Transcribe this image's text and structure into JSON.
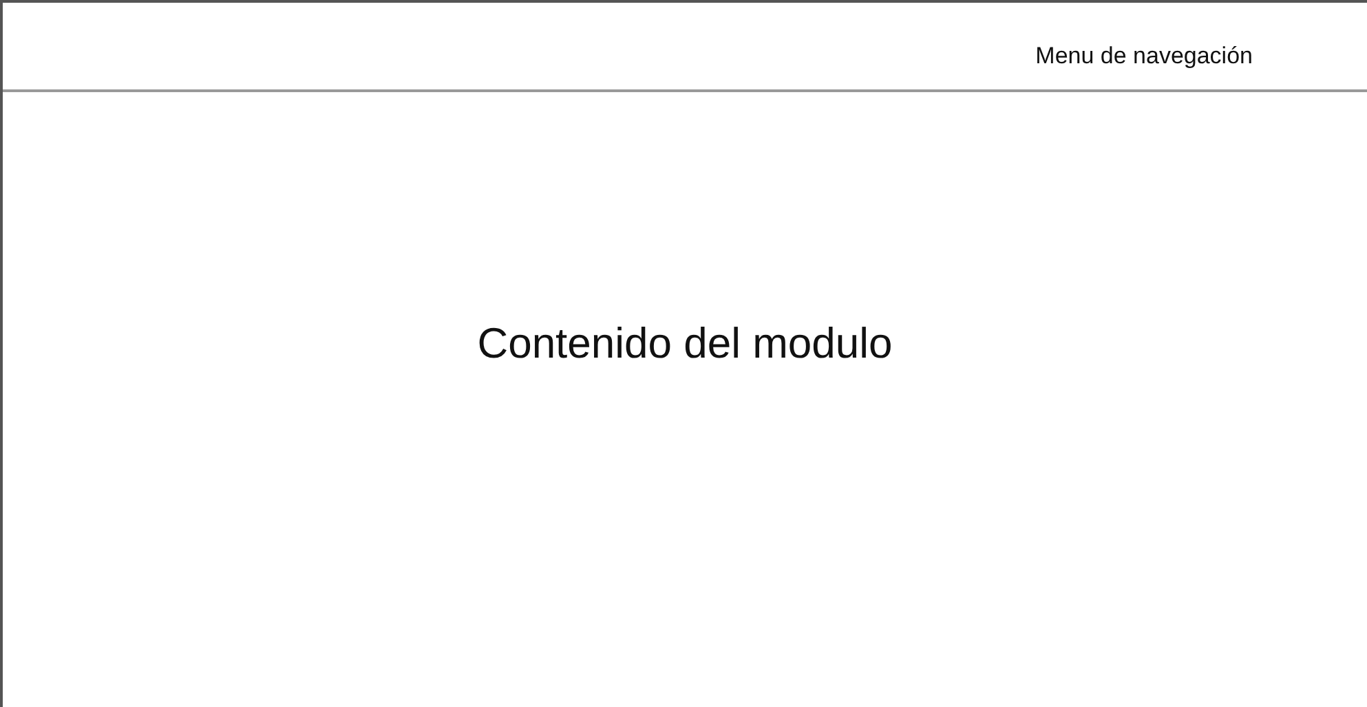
{
  "header": {
    "menu_label": "Menu de navegación"
  },
  "content": {
    "text": "Contenido del modulo"
  }
}
